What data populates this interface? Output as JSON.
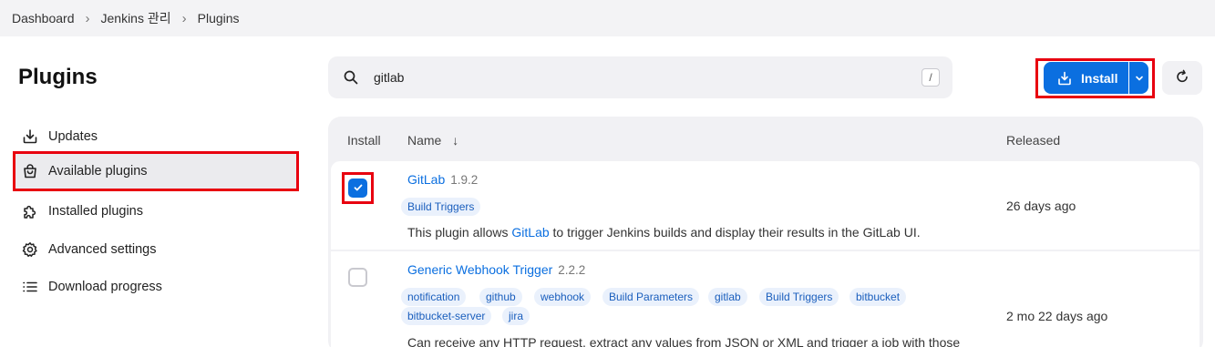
{
  "breadcrumb": [
    "Dashboard",
    "Jenkins 관리",
    "Plugins"
  ],
  "page_title": "Plugins",
  "sidebar": {
    "items": [
      {
        "label": "Updates",
        "icon": "download-icon"
      },
      {
        "label": "Available plugins",
        "icon": "shopping-bag-icon",
        "active": true
      },
      {
        "label": "Installed plugins",
        "icon": "puzzle-icon"
      },
      {
        "label": "Advanced settings",
        "icon": "gear-icon"
      },
      {
        "label": "Download progress",
        "icon": "list-icon"
      }
    ]
  },
  "search": {
    "value": "gitlab",
    "shortcut": "/"
  },
  "toolbar": {
    "install_label": "Install"
  },
  "table": {
    "headers": {
      "install": "Install",
      "name": "Name",
      "sort_indicator": "↓",
      "released": "Released"
    },
    "rows": [
      {
        "checked": true,
        "name": "GitLab",
        "version": "1.9.2",
        "tags": [
          "Build Triggers"
        ],
        "description": {
          "pre": "This plugin allows ",
          "link": "GitLab",
          "post": " to trigger Jenkins builds and display their results in the GitLab UI."
        },
        "released": "26 days ago"
      },
      {
        "checked": false,
        "name": "Generic Webhook Trigger",
        "version": "2.2.2",
        "tags": [
          "notification",
          "github",
          "webhook",
          "Build Parameters",
          "gitlab",
          "Build Triggers",
          "bitbucket",
          "bitbucket-server",
          "jira"
        ],
        "description": {
          "pre": "Can receive any HTTP request, extract any values from JSON or XML and trigger a job with those",
          "link": "",
          "post": ""
        },
        "released": "2 mo 22 days ago"
      }
    ]
  },
  "colors": {
    "accent": "#0b6fe0",
    "highlight": "#e8000f",
    "tag_bg": "#eaf1fc"
  }
}
